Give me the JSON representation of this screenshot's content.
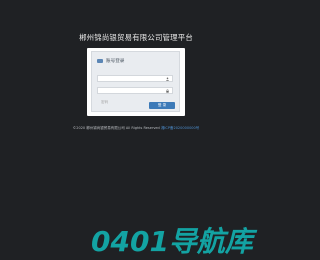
{
  "page": {
    "title": "郴州锦尚银贸易有限公司管理平台"
  },
  "login": {
    "header": "账号登录",
    "username_placeholder": "用户名",
    "password_placeholder": "密码",
    "submit_label": "登 录"
  },
  "footer": {
    "copyright": "©2020 郴州锦尚银贸易有限公司 All Rights Reserved",
    "icp": "湘ICP备2020000000号"
  },
  "watermark": {
    "text": "0401导航库"
  },
  "colors": {
    "background": "#1f2124",
    "accent": "#3d7ab8",
    "watermark": "#13a3a3"
  }
}
